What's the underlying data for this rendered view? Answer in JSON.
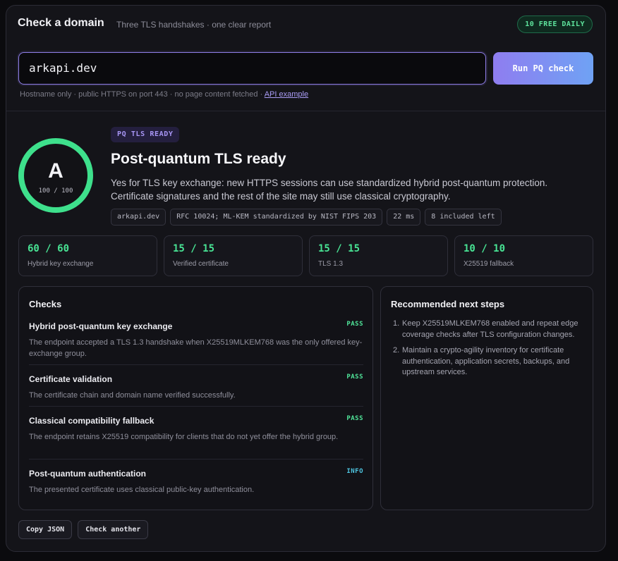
{
  "header": {
    "title": "Check a domain",
    "subtitle": "Three TLS handshakes · one clear report",
    "badge": "10 FREE DAILY"
  },
  "search": {
    "value": "arkapi.dev",
    "button_label": "Run PQ check",
    "hint": "Hostname only · public HTTPS on port 443 · no page content fetched ·",
    "hint_link": "API example"
  },
  "result": {
    "grade": "A",
    "score": "100 / 100",
    "status_pill": "PQ TLS READY",
    "title": "Post-quantum TLS ready",
    "description": "Yes for TLS key exchange: new HTTPS sessions can use standardized hybrid post-quantum protection. Certificate signatures and the rest of the site may still use classical cryptography.",
    "meta": [
      "arkapi.dev",
      "RFC 10024; ML-KEM standardized by NIST FIPS 203",
      "22 ms",
      "8 included left"
    ]
  },
  "scores": [
    {
      "value": "60 / 60",
      "label": "Hybrid key exchange"
    },
    {
      "value": "15 / 15",
      "label": "Verified certificate"
    },
    {
      "value": "15 / 15",
      "label": "TLS 1.3"
    },
    {
      "value": "10 / 10",
      "label": "X25519 fallback"
    }
  ],
  "checks": {
    "title": "Checks",
    "items": [
      {
        "name": "Hybrid post-quantum key exchange",
        "status": "PASS",
        "desc": "The endpoint accepted a TLS 1.3 handshake when X25519MLKEM768 was the only offered key-exchange group."
      },
      {
        "name": "Certificate validation",
        "status": "PASS",
        "desc": "The certificate chain and domain name verified successfully."
      },
      {
        "name": "Classical compatibility fallback",
        "status": "PASS",
        "desc": "The endpoint retains X25519 compatibility for clients that do not yet offer the hybrid group."
      },
      {
        "name": "Post-quantum authentication",
        "status": "INFO",
        "desc": "The presented certificate uses classical public-key authentication."
      }
    ]
  },
  "next_steps": {
    "title": "Recommended next steps",
    "items": [
      {
        "num": "1.",
        "text": "Keep X25519MLKEM768 enabled and repeat edge coverage checks after TLS configuration changes."
      },
      {
        "num": "2.",
        "text": "Maintain a crypto-agility inventory for certificate authentication, application secrets, backups, and upstream services."
      }
    ]
  },
  "footer": {
    "copy_json": "Copy JSON",
    "check_another": "Check another"
  },
  "colors": {
    "accent_purple": "#8f7ee8",
    "accent_green": "#3ee08c",
    "info_cyan": "#4fc7e3"
  }
}
